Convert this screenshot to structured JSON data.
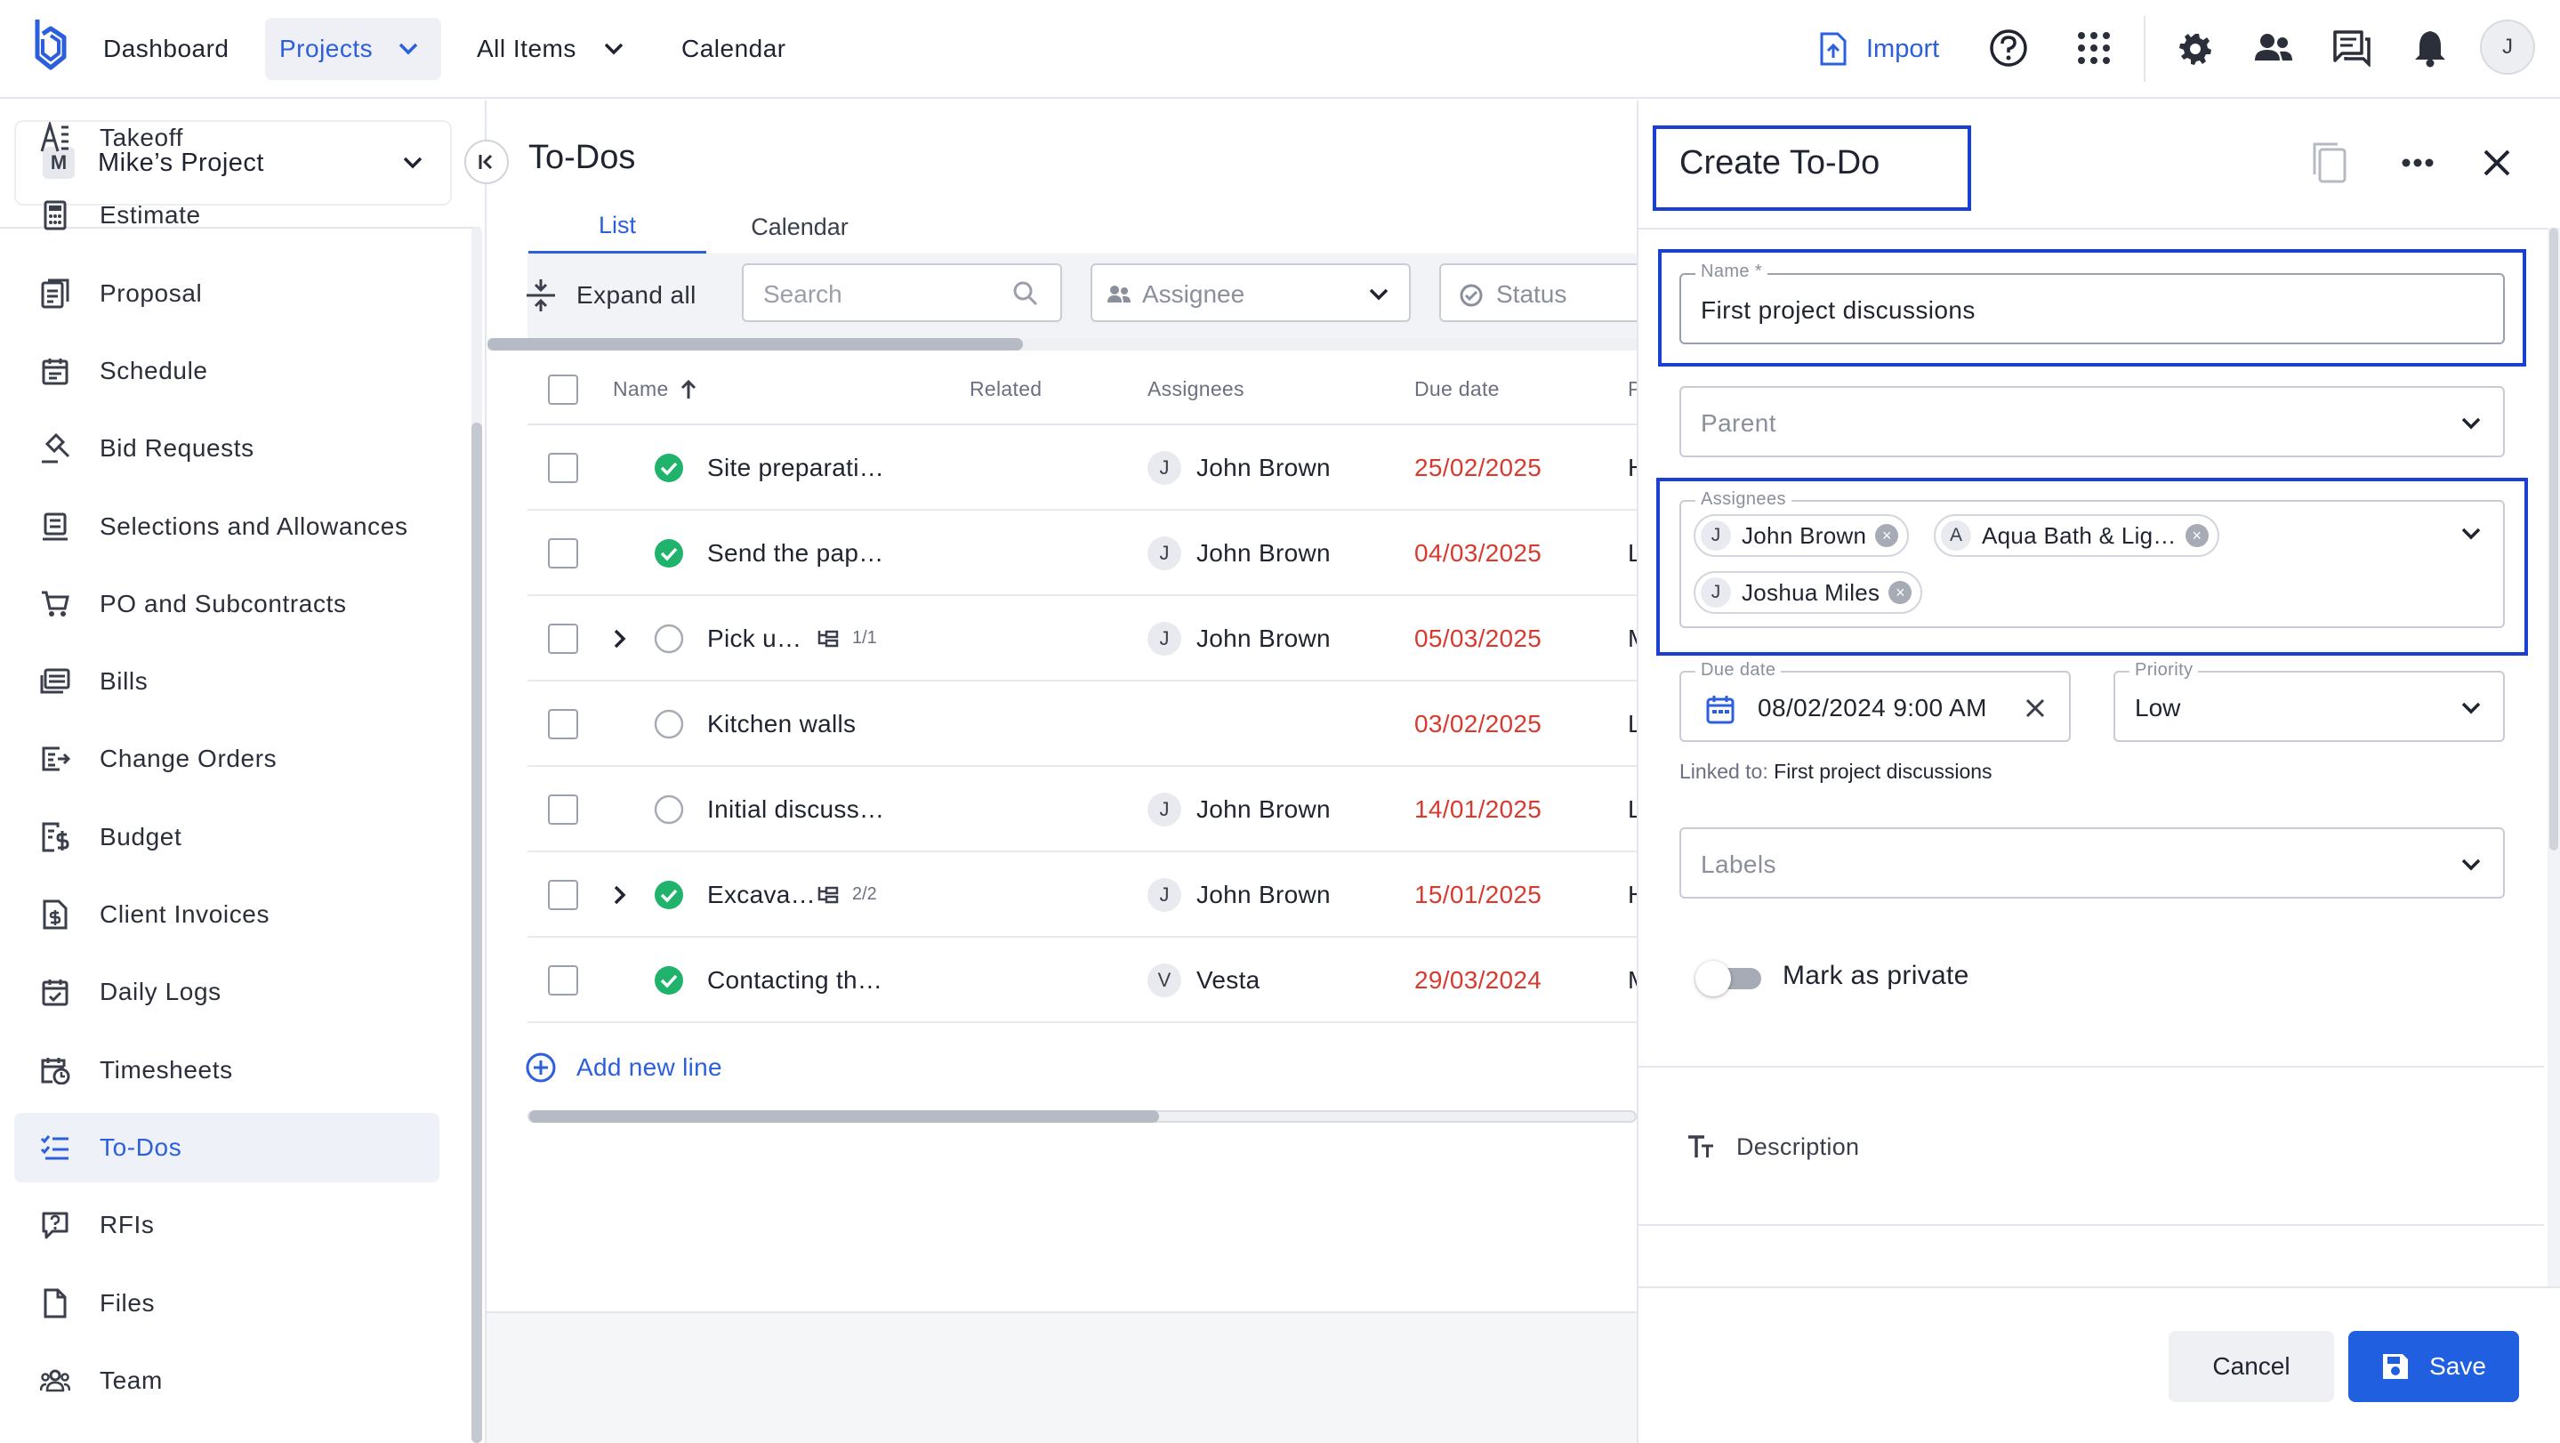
{
  "topbar": {
    "dashboard": "Dashboard",
    "projects": "Projects",
    "all_items": "All Items",
    "calendar": "Calendar",
    "import": "Import",
    "user_initial": "J"
  },
  "sidebar": {
    "project_badge": "M",
    "project_name": "Mike’s Project",
    "items": [
      {
        "label": "Takeoff",
        "icon": "takeoff-icon"
      },
      {
        "label": "Estimate",
        "icon": "calculator-icon"
      },
      {
        "label": "Proposal",
        "icon": "proposal-icon"
      },
      {
        "label": "Schedule",
        "icon": "schedule-icon"
      },
      {
        "label": "Bid Requests",
        "icon": "gavel-icon"
      },
      {
        "label": "Selections and Allowances",
        "icon": "selections-icon"
      },
      {
        "label": "PO and Subcontracts",
        "icon": "cart-icon"
      },
      {
        "label": "Bills",
        "icon": "bills-icon"
      },
      {
        "label": "Change Orders",
        "icon": "change-orders-icon"
      },
      {
        "label": "Budget",
        "icon": "budget-icon"
      },
      {
        "label": "Client Invoices",
        "icon": "invoice-icon"
      },
      {
        "label": "Daily Logs",
        "icon": "daily-log-icon"
      },
      {
        "label": "Timesheets",
        "icon": "timesheet-icon"
      },
      {
        "label": "To-Dos",
        "icon": "todo-icon"
      },
      {
        "label": "RFIs",
        "icon": "rfi-icon"
      },
      {
        "label": "Files",
        "icon": "file-icon"
      },
      {
        "label": "Team",
        "icon": "team-icon"
      }
    ],
    "active": "To-Dos"
  },
  "main": {
    "title": "To-Dos",
    "tabs": [
      "List",
      "Calendar"
    ],
    "active_tab": "List",
    "expand_all": "Expand all",
    "search_placeholder": "Search",
    "assignee_filter": "Assignee",
    "status_filter": "Status",
    "columns": {
      "name": "Name",
      "related": "Related",
      "assignees": "Assignees",
      "due_date": "Due date",
      "priority": "P"
    },
    "rows": [
      {
        "name": "Site preparati…",
        "status": "done",
        "expand": false,
        "subtasks": "",
        "assignee_initial": "J",
        "assignee": "John Brown",
        "due": "25/02/2025",
        "priority": "H"
      },
      {
        "name": "Send the pap…",
        "status": "done",
        "expand": false,
        "subtasks": "",
        "assignee_initial": "J",
        "assignee": "John Brown",
        "due": "04/03/2025",
        "priority": "L"
      },
      {
        "name": "Pick u…",
        "status": "open",
        "expand": true,
        "subtasks": "1/1",
        "assignee_initial": "J",
        "assignee": "John Brown",
        "due": "05/03/2025",
        "priority": "M"
      },
      {
        "name": "Kitchen walls",
        "status": "open",
        "expand": false,
        "subtasks": "",
        "assignee_initial": "",
        "assignee": "",
        "due": "03/02/2025",
        "priority": "L"
      },
      {
        "name": "Initial discuss…",
        "status": "open",
        "expand": false,
        "subtasks": "",
        "assignee_initial": "J",
        "assignee": "John Brown",
        "due": "14/01/2025",
        "priority": "L"
      },
      {
        "name": "Excava…",
        "status": "done",
        "expand": true,
        "subtasks": "2/2",
        "assignee_initial": "J",
        "assignee": "John Brown",
        "due": "15/01/2025",
        "priority": "H"
      },
      {
        "name": "Contacting th…",
        "status": "done",
        "expand": false,
        "subtasks": "",
        "assignee_initial": "V",
        "assignee": "Vesta",
        "due": "29/03/2024",
        "priority": "M"
      }
    ],
    "add_new_line": "Add new line"
  },
  "drawer": {
    "title": "Create To-Do",
    "name_label": "Name *",
    "name_value": "First project discussions",
    "parent_placeholder": "Parent",
    "assignees_label": "Assignees",
    "assignees": [
      {
        "initial": "J",
        "name": "John Brown"
      },
      {
        "initial": "A",
        "name": "Aqua Bath & Lig…"
      },
      {
        "initial": "J",
        "name": "Joshua Miles"
      }
    ],
    "due_label": "Due date",
    "due_value": "08/02/2024 9:00 AM",
    "priority_label": "Priority",
    "priority_value": "Low",
    "linked_prefix": "Linked to:",
    "linked_value": "First project discussions",
    "labels_placeholder": "Labels",
    "private_label": "Mark as private",
    "private_on": false,
    "description_label": "Description",
    "cancel": "Cancel",
    "save": "Save"
  },
  "colors": {
    "accent": "#2c5fdc",
    "done_green": "#1fb36b",
    "due_red": "#d93a2f",
    "highlight_blue": "#1a3fd1"
  }
}
